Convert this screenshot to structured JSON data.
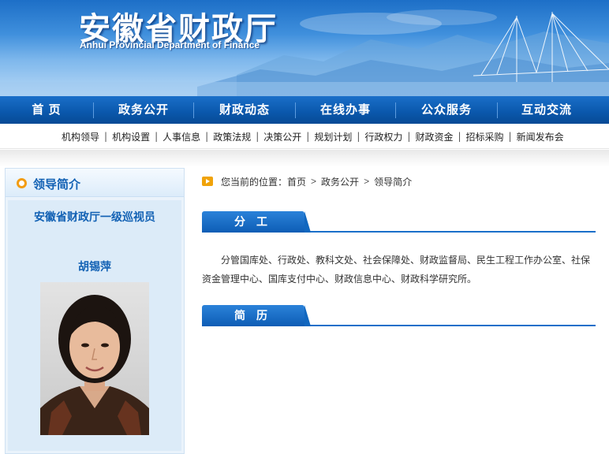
{
  "banner": {
    "title": "安徽省财政厅",
    "subtitle": "Anhui Provincial Department of Finance"
  },
  "main_nav": [
    {
      "label": "首  页"
    },
    {
      "label": "政务公开"
    },
    {
      "label": "财政动态"
    },
    {
      "label": "在线办事"
    },
    {
      "label": "公众服务"
    },
    {
      "label": "互动交流"
    }
  ],
  "sub_nav": [
    {
      "label": "机构领导"
    },
    {
      "label": "机构设置"
    },
    {
      "label": "人事信息"
    },
    {
      "label": "政策法规"
    },
    {
      "label": "决策公开"
    },
    {
      "label": "规划计划"
    },
    {
      "label": "行政权力"
    },
    {
      "label": "财政资金"
    },
    {
      "label": "招标采购"
    },
    {
      "label": "新闻发布会"
    }
  ],
  "sidebar": {
    "title": "领导简介",
    "position": "安徽省财政厅一级巡视员",
    "name": "胡锡萍"
  },
  "breadcrumb": {
    "prefix": "您当前的位置：",
    "items": [
      {
        "label": "首页"
      },
      {
        "label": "政务公开"
      },
      {
        "label": "领导简介"
      }
    ]
  },
  "sections": {
    "duty_title": "分工",
    "duty_text": "分管国库处、行政处、教科文处、社会保障处、财政监督局、民生工程工作办公室、社保资金管理中心、国库支付中心、财政信息中心、财政科学研究所。",
    "resume_title": "简历"
  },
  "colors": {
    "primary_blue": "#0a57ab",
    "accent_orange": "#f39c12",
    "link_blue": "#1261b4"
  }
}
